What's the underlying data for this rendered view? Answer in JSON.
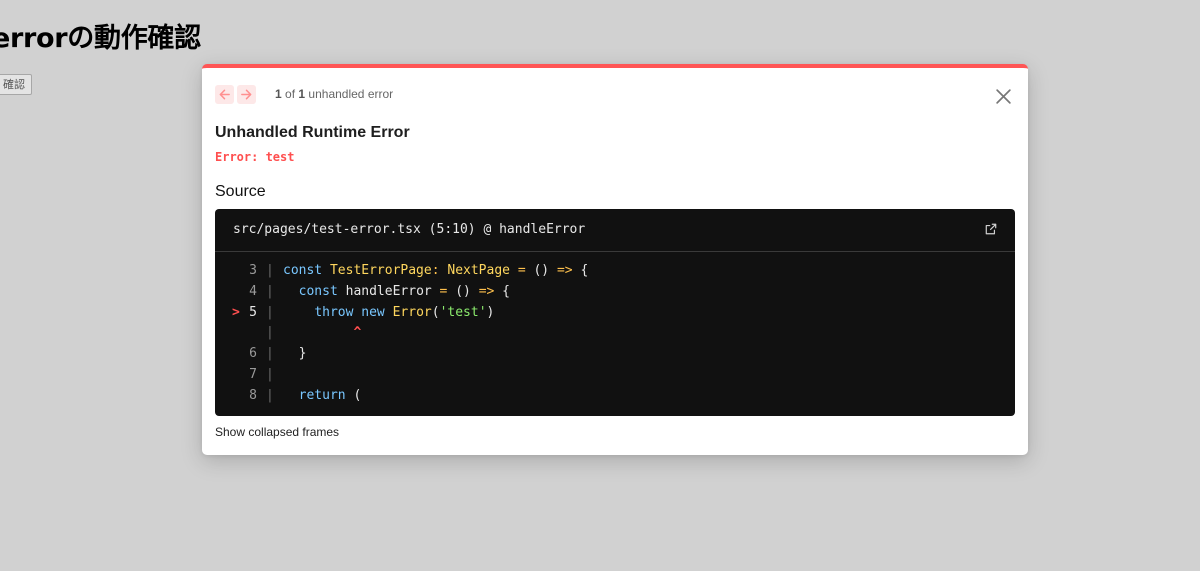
{
  "page": {
    "title": "errorの動作確認",
    "button_label": "確認"
  },
  "dialog": {
    "error_index": "1",
    "error_of": "of",
    "error_total": "1",
    "error_suffix": "unhandled error",
    "title": "Unhandled Runtime Error",
    "message": "Error: test",
    "source_heading": "Source",
    "location": "src/pages/test-error.tsx (5:10) @ handleError",
    "collapsed_frames_label": "Show collapsed frames",
    "code": {
      "marker": ">",
      "bar": "|",
      "caret": "^",
      "lines": [
        {
          "num": "3",
          "tokens": [
            [
              "kw",
              "const"
            ],
            [
              "plain",
              " "
            ],
            [
              "fn",
              "TestErrorPage"
            ],
            [
              "op",
              ":"
            ],
            [
              "plain",
              " "
            ],
            [
              "fn",
              "NextPage"
            ],
            [
              "plain",
              " "
            ],
            [
              "op",
              "="
            ],
            [
              "plain",
              " () "
            ],
            [
              "op",
              "=>"
            ],
            [
              "plain",
              " {"
            ]
          ]
        },
        {
          "num": "4",
          "tokens": [
            [
              "plain",
              "  "
            ],
            [
              "kw",
              "const"
            ],
            [
              "plain",
              " handleError "
            ],
            [
              "op",
              "="
            ],
            [
              "plain",
              " () "
            ],
            [
              "op",
              "=>"
            ],
            [
              "plain",
              " {"
            ]
          ]
        },
        {
          "num": "5",
          "tokens": [
            [
              "plain",
              "    "
            ],
            [
              "kw",
              "throw"
            ],
            [
              "plain",
              " "
            ],
            [
              "kw",
              "new"
            ],
            [
              "plain",
              " "
            ],
            [
              "fn",
              "Error"
            ],
            [
              "plain",
              "("
            ],
            [
              "str",
              "'test'"
            ],
            [
              "plain",
              ")"
            ]
          ]
        },
        {
          "num": "",
          "tokens": []
        },
        {
          "num": "6",
          "tokens": [
            [
              "plain",
              "  }"
            ]
          ]
        },
        {
          "num": "7",
          "tokens": []
        },
        {
          "num": "8",
          "tokens": [
            [
              "plain",
              "  "
            ],
            [
              "kw",
              "return"
            ],
            [
              "plain",
              " ("
            ]
          ]
        }
      ]
    }
  },
  "colors": {
    "accent_red": "#ff5555",
    "code_bg": "#111111",
    "keyword": "#79c7ff",
    "identifier": "#ffd75e",
    "string": "#8bea6d"
  }
}
